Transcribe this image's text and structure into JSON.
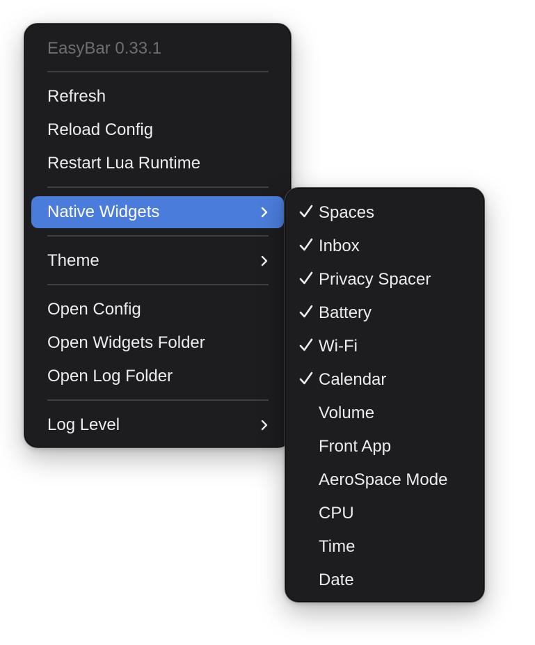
{
  "main_menu": {
    "title": "EasyBar 0.33.1",
    "items": [
      {
        "label": "Refresh"
      },
      {
        "label": "Reload Config"
      },
      {
        "label": "Restart Lua Runtime"
      },
      {
        "label": "Native Widgets",
        "has_submenu": true,
        "highlighted": true
      },
      {
        "label": "Theme",
        "has_submenu": true
      },
      {
        "label": "Open Config"
      },
      {
        "label": "Open Widgets Folder"
      },
      {
        "label": "Open Log Folder"
      },
      {
        "label": "Log Level",
        "has_submenu": true
      }
    ],
    "icons": {
      "submenu": "chevron-right-icon"
    }
  },
  "submenu": {
    "items": [
      {
        "label": "Spaces",
        "checked": true
      },
      {
        "label": "Inbox",
        "checked": true
      },
      {
        "label": "Privacy Spacer",
        "checked": true
      },
      {
        "label": "Battery",
        "checked": true
      },
      {
        "label": "Wi-Fi",
        "checked": true
      },
      {
        "label": "Calendar",
        "checked": true
      },
      {
        "label": "Volume",
        "checked": false
      },
      {
        "label": "Front App",
        "checked": false
      },
      {
        "label": "AeroSpace Mode",
        "checked": false
      },
      {
        "label": "CPU",
        "checked": false
      },
      {
        "label": "Time",
        "checked": false
      },
      {
        "label": "Date",
        "checked": false
      }
    ],
    "icons": {
      "checked": "checkmark-icon"
    }
  },
  "colors": {
    "menu_background": "#1d1d1f",
    "highlight": "#4a7ddb",
    "text": "#ececef",
    "disabled_text": "#6e6e73",
    "separator": "#3f3f43"
  }
}
